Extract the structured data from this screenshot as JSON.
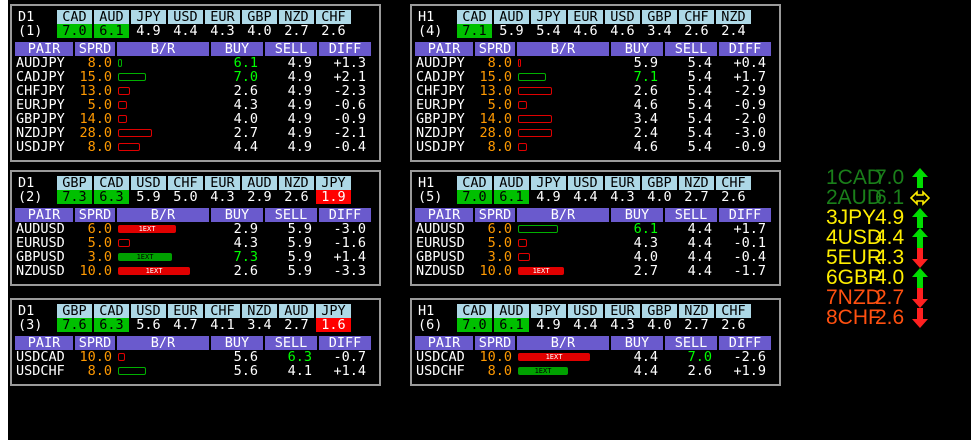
{
  "panels": [
    {
      "tf": "D1",
      "idx": "(1)",
      "currencies": [
        "CAD",
        "AUD",
        "JPY",
        "USD",
        "EUR",
        "GBP",
        "NZD",
        "CHF"
      ],
      "values": [
        "7.0",
        "6.1",
        "4.9",
        "4.4",
        "4.3",
        "4.0",
        "2.7",
        "2.6"
      ],
      "vstyle": [
        "green",
        "green",
        "plain",
        "plain",
        "plain",
        "plain",
        "plain",
        "plain"
      ],
      "headers": [
        "PAIR",
        "SPRD",
        "B/R",
        "BUY",
        "SELL",
        "DIFF"
      ],
      "rows": [
        {
          "pair": "AUDJPY",
          "sprd": "8.0",
          "bar": "g",
          "bw": 2,
          "btext": "",
          "buy": "6.1",
          "buyg": true,
          "sell": "4.9",
          "sellg": false,
          "diff": "+1.3"
        },
        {
          "pair": "CADJPY",
          "sprd": "15.0",
          "bar": "g",
          "bw": 26,
          "btext": "",
          "buy": "7.0",
          "buyg": true,
          "sell": "4.9",
          "sellg": false,
          "diff": "+2.1"
        },
        {
          "pair": "CHFJPY",
          "sprd": "13.0",
          "bar": "r",
          "bw": 10,
          "btext": "",
          "buy": "2.6",
          "buyg": false,
          "sell": "4.9",
          "sellg": false,
          "diff": "-2.3"
        },
        {
          "pair": "EURJPY",
          "sprd": "5.0",
          "bar": "r",
          "bw": 7,
          "btext": "",
          "buy": "4.3",
          "buyg": false,
          "sell": "4.9",
          "sellg": false,
          "diff": "-0.6"
        },
        {
          "pair": "GBPJPY",
          "sprd": "14.0",
          "bar": "r",
          "bw": 7,
          "btext": "",
          "buy": "4.0",
          "buyg": false,
          "sell": "4.9",
          "sellg": false,
          "diff": "-0.9"
        },
        {
          "pair": "NZDJPY",
          "sprd": "28.0",
          "bar": "r",
          "bw": 32,
          "btext": "",
          "buy": "2.7",
          "buyg": false,
          "sell": "4.9",
          "sellg": false,
          "diff": "-2.1"
        },
        {
          "pair": "USDJPY",
          "sprd": "8.0",
          "bar": "r",
          "bw": 20,
          "btext": "",
          "buy": "4.4",
          "buyg": false,
          "sell": "4.9",
          "sellg": false,
          "diff": "-0.4"
        }
      ]
    },
    {
      "tf": "H1",
      "idx": "(4)",
      "currencies": [
        "CAD",
        "AUD",
        "JPY",
        "EUR",
        "USD",
        "GBP",
        "CHF",
        "NZD"
      ],
      "values": [
        "7.1",
        "5.9",
        "5.4",
        "4.6",
        "4.6",
        "3.4",
        "2.6",
        "2.4"
      ],
      "vstyle": [
        "green",
        "plain",
        "plain",
        "plain",
        "plain",
        "plain",
        "plain",
        "plain"
      ],
      "headers": [
        "PAIR",
        "SPRD",
        "B/R",
        "BUY",
        "SELL",
        "DIFF"
      ],
      "rows": [
        {
          "pair": "AUDJPY",
          "sprd": "8.0",
          "bar": "r",
          "bw": 1,
          "btext": "",
          "buy": "5.9",
          "buyg": false,
          "sell": "5.4",
          "sellg": false,
          "diff": "+0.4"
        },
        {
          "pair": "CADJPY",
          "sprd": "15.0",
          "bar": "g",
          "bw": 26,
          "btext": "",
          "buy": "7.1",
          "buyg": true,
          "sell": "5.4",
          "sellg": false,
          "diff": "+1.7"
        },
        {
          "pair": "CHFJPY",
          "sprd": "13.0",
          "bar": "r",
          "bw": 32,
          "btext": "",
          "buy": "2.6",
          "buyg": false,
          "sell": "5.4",
          "sellg": false,
          "diff": "-2.9"
        },
        {
          "pair": "EURJPY",
          "sprd": "5.0",
          "bar": "r",
          "bw": 7,
          "btext": "",
          "buy": "4.6",
          "buyg": false,
          "sell": "5.4",
          "sellg": false,
          "diff": "-0.9"
        },
        {
          "pair": "GBPJPY",
          "sprd": "14.0",
          "bar": "r",
          "bw": 32,
          "btext": "",
          "buy": "3.4",
          "buyg": false,
          "sell": "5.4",
          "sellg": false,
          "diff": "-2.0"
        },
        {
          "pair": "NZDJPY",
          "sprd": "28.0",
          "bar": "r",
          "bw": 32,
          "btext": "",
          "buy": "2.4",
          "buyg": false,
          "sell": "5.4",
          "sellg": false,
          "diff": "-3.0"
        },
        {
          "pair": "USDJPY",
          "sprd": "8.0",
          "bar": "r",
          "bw": 7,
          "btext": "",
          "buy": "4.6",
          "buyg": false,
          "sell": "5.4",
          "sellg": false,
          "diff": "-0.9"
        }
      ]
    },
    {
      "tf": "D1",
      "idx": "(2)",
      "currencies": [
        "GBP",
        "CAD",
        "USD",
        "CHF",
        "EUR",
        "AUD",
        "NZD",
        "JPY"
      ],
      "values": [
        "7.3",
        "6.3",
        "5.9",
        "5.0",
        "4.3",
        "2.9",
        "2.6",
        "1.9"
      ],
      "vstyle": [
        "green",
        "green",
        "plain",
        "plain",
        "plain",
        "plain",
        "plain",
        "red"
      ],
      "headers": [
        "PAIR",
        "SPRD",
        "B/R",
        "BUY",
        "SELL",
        "DIFF"
      ],
      "rows": [
        {
          "pair": "AUDUSD",
          "sprd": "6.0",
          "bar": "fr",
          "bw": 56,
          "btext": "1EXT",
          "buy": "2.9",
          "buyg": false,
          "sell": "5.9",
          "sellg": false,
          "diff": "-3.0"
        },
        {
          "pair": "EURUSD",
          "sprd": "5.0",
          "bar": "r",
          "bw": 10,
          "btext": "",
          "buy": "4.3",
          "buyg": false,
          "sell": "5.9",
          "sellg": false,
          "diff": "-1.6"
        },
        {
          "pair": "GBPUSD",
          "sprd": "3.0",
          "bar": "fg",
          "bw": 52,
          "btext": "1EXT",
          "buy": "7.3",
          "buyg": true,
          "sell": "5.9",
          "sellg": false,
          "diff": "+1.4"
        },
        {
          "pair": "NZDUSD",
          "sprd": "10.0",
          "bar": "fr",
          "bw": 70,
          "btext": "1EXT",
          "buy": "2.6",
          "buyg": false,
          "sell": "5.9",
          "sellg": false,
          "diff": "-3.3"
        }
      ]
    },
    {
      "tf": "H1",
      "idx": "(5)",
      "currencies": [
        "CAD",
        "AUD",
        "JPY",
        "USD",
        "EUR",
        "GBP",
        "NZD",
        "CHF"
      ],
      "values": [
        "7.0",
        "6.1",
        "4.9",
        "4.4",
        "4.3",
        "4.0",
        "2.7",
        "2.6"
      ],
      "vstyle": [
        "green",
        "green",
        "plain",
        "plain",
        "plain",
        "plain",
        "plain",
        "plain"
      ],
      "headers": [
        "PAIR",
        "SPRD",
        "B/R",
        "BUY",
        "SELL",
        "DIFF"
      ],
      "rows": [
        {
          "pair": "AUDUSD",
          "sprd": "6.0",
          "bar": "g",
          "bw": 38,
          "btext": "",
          "buy": "6.1",
          "buyg": true,
          "sell": "4.4",
          "sellg": false,
          "diff": "+1.7"
        },
        {
          "pair": "EURUSD",
          "sprd": "5.0",
          "bar": "r",
          "bw": 7,
          "btext": "",
          "buy": "4.3",
          "buyg": false,
          "sell": "4.4",
          "sellg": false,
          "diff": "-0.1"
        },
        {
          "pair": "GBPUSD",
          "sprd": "3.0",
          "bar": "r",
          "bw": 10,
          "btext": "",
          "buy": "4.0",
          "buyg": false,
          "sell": "4.4",
          "sellg": false,
          "diff": "-0.4"
        },
        {
          "pair": "NZDUSD",
          "sprd": "10.0",
          "bar": "fr",
          "bw": 44,
          "btext": "1EXT",
          "buy": "2.7",
          "buyg": false,
          "sell": "4.4",
          "sellg": false,
          "diff": "-1.7"
        }
      ]
    },
    {
      "tf": "D1",
      "idx": "(3)",
      "currencies": [
        "GBP",
        "CAD",
        "USD",
        "EUR",
        "CHF",
        "NZD",
        "AUD",
        "JPY"
      ],
      "values": [
        "7.6",
        "6.3",
        "5.6",
        "4.7",
        "4.1",
        "3.4",
        "2.7",
        "1.6"
      ],
      "vstyle": [
        "green",
        "green",
        "plain",
        "plain",
        "plain",
        "plain",
        "plain",
        "red"
      ],
      "headers": [
        "PAIR",
        "SPRD",
        "B/R",
        "BUY",
        "SELL",
        "DIFF"
      ],
      "rows": [
        {
          "pair": "USDCAD",
          "sprd": "10.0",
          "bar": "r",
          "bw": 5,
          "btext": "",
          "buy": "5.6",
          "buyg": false,
          "sell": "6.3",
          "sellg": true,
          "diff": "-0.7"
        },
        {
          "pair": "USDCHF",
          "sprd": "8.0",
          "bar": "g",
          "bw": 26,
          "btext": "",
          "buy": "5.6",
          "buyg": false,
          "sell": "4.1",
          "sellg": false,
          "diff": "+1.4"
        }
      ]
    },
    {
      "tf": "H1",
      "idx": "(6)",
      "currencies": [
        "CAD",
        "AUD",
        "JPY",
        "USD",
        "EUR",
        "GBP",
        "NZD",
        "CHF"
      ],
      "values": [
        "7.0",
        "6.1",
        "4.9",
        "4.4",
        "4.3",
        "4.0",
        "2.7",
        "2.6"
      ],
      "vstyle": [
        "green",
        "green",
        "plain",
        "plain",
        "plain",
        "plain",
        "plain",
        "plain"
      ],
      "headers": [
        "PAIR",
        "SPRD",
        "B/R",
        "BUY",
        "SELL",
        "DIFF"
      ],
      "rows": [
        {
          "pair": "USDCAD",
          "sprd": "10.0",
          "bar": "fr",
          "bw": 70,
          "btext": "1EXT",
          "buy": "4.4",
          "buyg": false,
          "sell": "7.0",
          "sellg": true,
          "diff": "-2.6"
        },
        {
          "pair": "USDCHF",
          "sprd": "8.0",
          "bar": "fg",
          "bw": 48,
          "btext": "1EXT",
          "buy": "4.4",
          "buyg": false,
          "sell": "2.6",
          "sellg": false,
          "diff": "+1.9"
        }
      ]
    }
  ],
  "strength": [
    {
      "rank": "1CAD",
      "value": "7.0",
      "color": "#1a7f1a",
      "arrow": "up-icon",
      "arrowColor": "#00dd00"
    },
    {
      "rank": "2AUD",
      "value": "6.1",
      "color": "#1a7f1a",
      "arrow": "double-arrow-icon",
      "arrowColor": "#ffee00"
    },
    {
      "rank": "3JPY",
      "value": "4.9",
      "color": "#ffee00",
      "arrow": "up-icon",
      "arrowColor": "#00dd00"
    },
    {
      "rank": "4USD",
      "value": "4.4",
      "color": "#ffee00",
      "arrow": "up-icon",
      "arrowColor": "#00dd00"
    },
    {
      "rank": "5EUR",
      "value": "4.3",
      "color": "#ffee00",
      "arrow": "down-icon",
      "arrowColor": "#ff2020"
    },
    {
      "rank": "6GBP",
      "value": "4.0",
      "color": "#ffee00",
      "arrow": "up-icon",
      "arrowColor": "#00dd00"
    },
    {
      "rank": "7NZD",
      "value": "2.7",
      "color": "#ff5010",
      "arrow": "down-icon",
      "arrowColor": "#ff2020"
    },
    {
      "rank": "8CHF",
      "value": "2.6",
      "color": "#ff5010",
      "arrow": "down-icon",
      "arrowColor": "#ff2020"
    }
  ]
}
